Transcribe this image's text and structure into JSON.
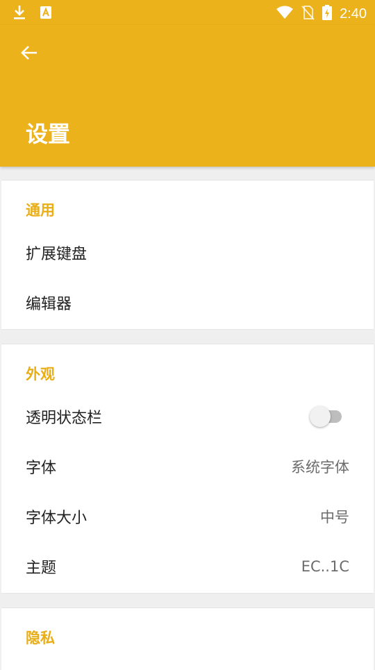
{
  "status_bar": {
    "time": "2:40",
    "icons": [
      "download-icon",
      "app-notification-icon",
      "wifi-icon",
      "no-sim-icon",
      "battery-charging-icon"
    ]
  },
  "app_bar": {
    "title": "设置",
    "back_icon": "arrow-left-icon",
    "color": "#ecb21c"
  },
  "sections": {
    "general": {
      "header": "通用",
      "items": [
        {
          "title": "扩展键盘"
        },
        {
          "title": "编辑器"
        }
      ]
    },
    "appearance": {
      "header": "外观",
      "items": [
        {
          "title": "透明状态栏",
          "switch_on": false
        },
        {
          "title": "字体",
          "value": "系统字体"
        },
        {
          "title": "字体大小",
          "value": "中号"
        },
        {
          "title": "主题",
          "value": "EC..1C"
        }
      ]
    },
    "privacy": {
      "header": "隐私"
    }
  },
  "colors": {
    "accent": "#ecb21c",
    "section_header": "#e9ad16",
    "background": "#efefef"
  }
}
